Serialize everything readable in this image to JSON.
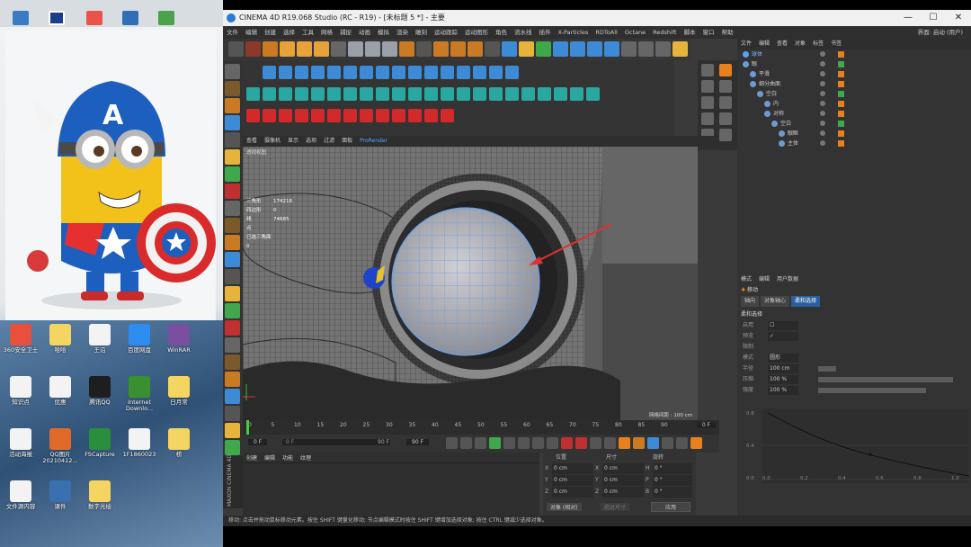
{
  "window": {
    "title": "CINEMA 4D R19.068 Studio (RC - R19) - [未标题 5 *] - 主要",
    "buttons": [
      "—",
      "☐",
      "✕"
    ]
  },
  "menu": {
    "items": [
      "文件",
      "编辑",
      "创建",
      "选择",
      "工具",
      "网格",
      "捕捉",
      "动画",
      "模拟",
      "渲染",
      "雕刻",
      "运动跟踪",
      "运动图形",
      "角色",
      "流水线",
      "插件",
      "X-Particles",
      "RDToAll",
      "Octane",
      "Redshift",
      "脚本",
      "窗口",
      "帮助"
    ],
    "right": "界面: 启动 (用户)"
  },
  "viewport": {
    "menu": [
      "查看",
      "摄像机",
      "显示",
      "选项",
      "过滤",
      "面板",
      "ProRender"
    ],
    "label": "透视视图",
    "hud": {
      "rows": [
        {
          "label": "三角形",
          "value": "174216"
        },
        {
          "label": "四边形",
          "value": "0"
        },
        {
          "label": "线",
          "value": "74685"
        },
        {
          "label": "点",
          "value": ""
        },
        {
          "label": "已选三角面 0",
          "value": ""
        }
      ]
    },
    "grid_info": "网格间距 : 100 cm"
  },
  "timeline": {
    "ticks": [
      "0",
      "5",
      "10",
      "15",
      "20",
      "25",
      "30",
      "35",
      "40",
      "45",
      "50",
      "55",
      "60",
      "65",
      "70",
      "75",
      "80",
      "85",
      "90"
    ],
    "end_frame": "0 F"
  },
  "transport": {
    "start": "0 F",
    "current": "0 F",
    "range_end": "90 F",
    "end": "90 F"
  },
  "materials": {
    "tabs": [
      "创建",
      "编辑",
      "功能",
      "纹理"
    ]
  },
  "coords": {
    "headers": [
      "位置",
      "尺寸",
      "旋转"
    ],
    "rows": [
      {
        "axis": "X",
        "pos": "0 cm",
        "size": "0 cm",
        "rot_label": "H",
        "rot": "0 °"
      },
      {
        "axis": "Y",
        "pos": "0 cm",
        "size": "0 cm",
        "rot_label": "P",
        "rot": "0 °"
      },
      {
        "axis": "Z",
        "pos": "0 cm",
        "size": "0 cm",
        "rot_label": "B",
        "rot": "0 °"
      }
    ],
    "mode": "对象 (相对)",
    "size_mode": "绝对尺寸",
    "apply": "应用"
  },
  "maxon": "MAXON CINEMA 4D",
  "status": "移动: 点击并拖动鼠标移动元素。按住 SHIFT 键量化移动; 节点编辑模式时按住 SHIFT 键增加选择对象; 按住 CTRL 键减少选择对象。",
  "objects": {
    "tabs": [
      "文件",
      "编辑",
      "查看",
      "对象",
      "标签",
      "书签"
    ],
    "rows": [
      {
        "indent": 0,
        "name": "球体",
        "color": "#7fb7ff"
      },
      {
        "indent": 0,
        "name": "眼",
        "color": "#cccccc"
      },
      {
        "indent": 1,
        "name": "平滑",
        "color": "#cccccc"
      },
      {
        "indent": 1,
        "name": "细分曲面",
        "color": "#cccccc"
      },
      {
        "indent": 2,
        "name": "空白",
        "color": "#cccccc"
      },
      {
        "indent": 3,
        "name": "内",
        "color": "#cccccc"
      },
      {
        "indent": 3,
        "name": "对称",
        "color": "#cccccc"
      },
      {
        "indent": 4,
        "name": "空白",
        "color": "#cccccc"
      },
      {
        "indent": 5,
        "name": "眼眶",
        "color": "#cccccc"
      },
      {
        "indent": 5,
        "name": "主体",
        "color": "#cccccc"
      }
    ]
  },
  "attributes": {
    "menu": [
      "模式",
      "编辑",
      "用户数据"
    ],
    "title": "移动",
    "tabs": [
      "轴向",
      "对象轴心",
      "柔和选择"
    ],
    "active_tab": "柔和选择",
    "section": "柔和选择",
    "rows": [
      {
        "label": "启用",
        "value": "☐"
      },
      {
        "label": "预览",
        "value": "✓"
      },
      {
        "label": "限制",
        "value": ""
      },
      {
        "label": "模式",
        "value": "圆形"
      },
      {
        "label": "半径",
        "value": "100 cm"
      },
      {
        "label": "压缩",
        "value": "100 %"
      },
      {
        "label": "强度",
        "value": "100 %"
      }
    ],
    "graph": {
      "y_ticks": [
        "0.8",
        "0.4",
        "0.0"
      ],
      "x_ticks": [
        "0.0",
        "0.2",
        "0.4",
        "0.6",
        "0.8",
        "1.0"
      ]
    }
  },
  "desktop": {
    "icons": [
      {
        "label": "360安全卫士",
        "color": "#e94f3d"
      },
      {
        "label": "哈哈",
        "color": "#f5d562"
      },
      {
        "label": "王沿",
        "color": "#f3f3f3"
      },
      {
        "label": "百度网盘",
        "color": "#2d8cf0"
      },
      {
        "label": "WinRAR",
        "color": "#7b4fa0"
      },
      {
        "label": "知识点",
        "color": "#f3f3f3"
      },
      {
        "label": "优惠",
        "color": "#f3f3f3"
      },
      {
        "label": "腾讯QQ",
        "color": "#1e1e1e"
      },
      {
        "label": "Internet Downlo...",
        "color": "#3a8f2f"
      },
      {
        "label": "日月常",
        "color": "#f5d562"
      },
      {
        "label": "活动海报",
        "color": "#f3f3f3"
      },
      {
        "label": "QQ图片 20210412...",
        "color": "#e06a2a"
      },
      {
        "label": "FSCapture",
        "color": "#2a8f3c"
      },
      {
        "label": "1F1860023",
        "color": "#f3f3f3"
      },
      {
        "label": "桥",
        "color": "#f5d562"
      },
      {
        "label": "文件源内容",
        "color": "#f3f3f3"
      },
      {
        "label": "课件",
        "color": "#3a6fb0"
      },
      {
        "label": "数字光绘",
        "color": "#f5d562"
      }
    ]
  }
}
